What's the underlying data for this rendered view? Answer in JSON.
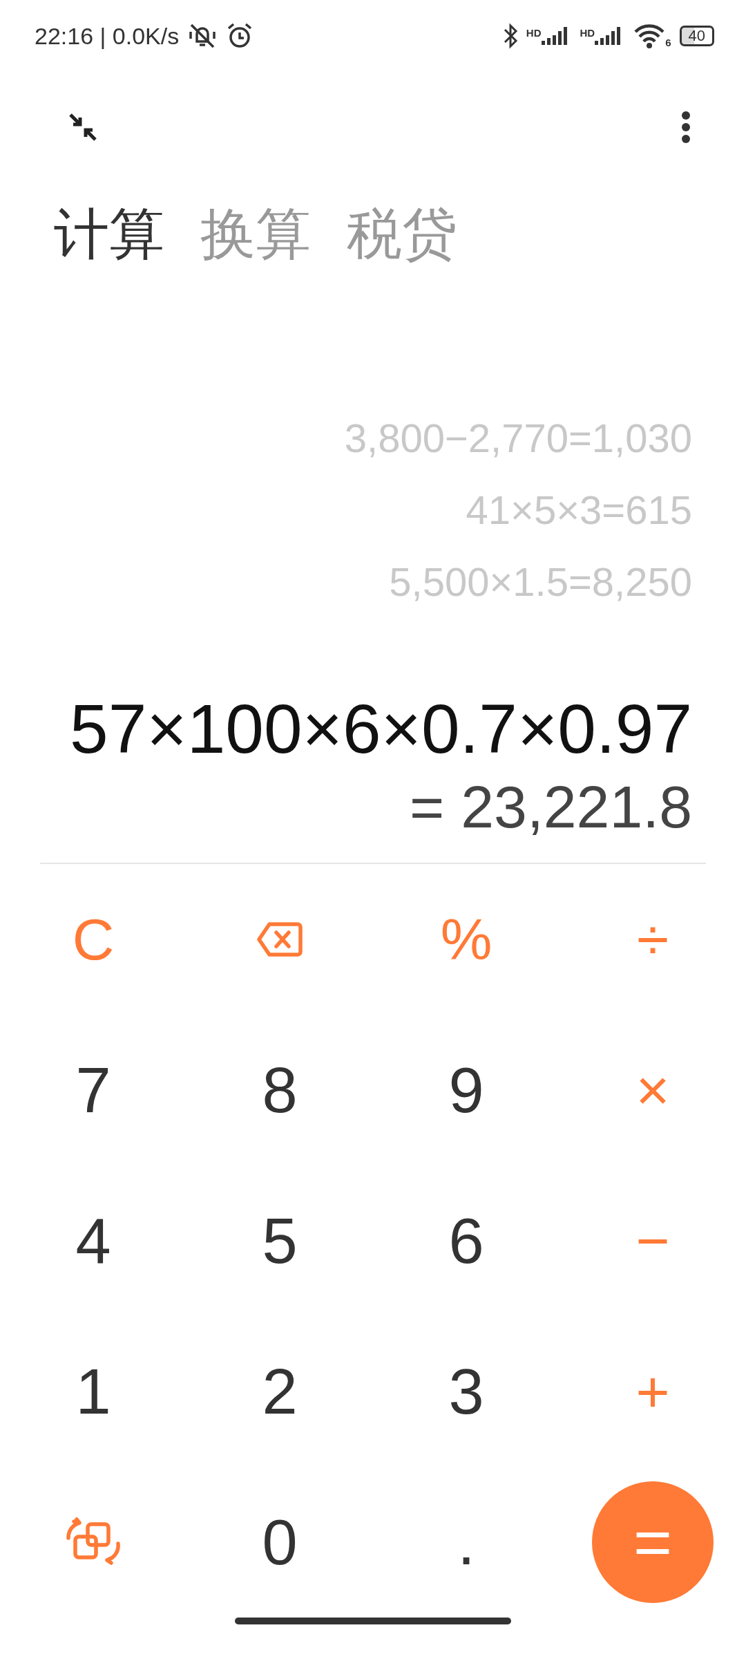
{
  "status_bar": {
    "time": "22:16 | 0.0K/s",
    "signals": [
      {
        "label": "HD"
      },
      {
        "label": "HD"
      }
    ],
    "wifi_label": "6",
    "battery": "40"
  },
  "tabs": [
    {
      "label": "计算",
      "selected": true
    },
    {
      "label": "换算",
      "selected": false
    },
    {
      "label": "税贷",
      "selected": false
    }
  ],
  "history": [
    "3,800−2,770=1,030",
    "41×5×3=615",
    "5,500×1.5=8,250"
  ],
  "expression": "57×100×6×0.7×0.97",
  "result": "= 23,221.8",
  "keys": [
    {
      "kind": "operator",
      "label": "C"
    },
    {
      "kind": "backspace"
    },
    {
      "kind": "operator",
      "label": "%"
    },
    {
      "kind": "operator",
      "label": "÷"
    },
    {
      "kind": "digit",
      "label": "7"
    },
    {
      "kind": "digit",
      "label": "8"
    },
    {
      "kind": "digit",
      "label": "9"
    },
    {
      "kind": "operator",
      "label": "×"
    },
    {
      "kind": "digit",
      "label": "4"
    },
    {
      "kind": "digit",
      "label": "5"
    },
    {
      "kind": "digit",
      "label": "6"
    },
    {
      "kind": "operator",
      "label": "−"
    },
    {
      "kind": "digit",
      "label": "1"
    },
    {
      "kind": "digit",
      "label": "2"
    },
    {
      "kind": "digit",
      "label": "3"
    },
    {
      "kind": "operator",
      "label": "+"
    },
    {
      "kind": "swap"
    },
    {
      "kind": "digit",
      "label": "0"
    },
    {
      "kind": "digit",
      "label": "."
    },
    {
      "kind": "equals",
      "label": "="
    }
  ]
}
